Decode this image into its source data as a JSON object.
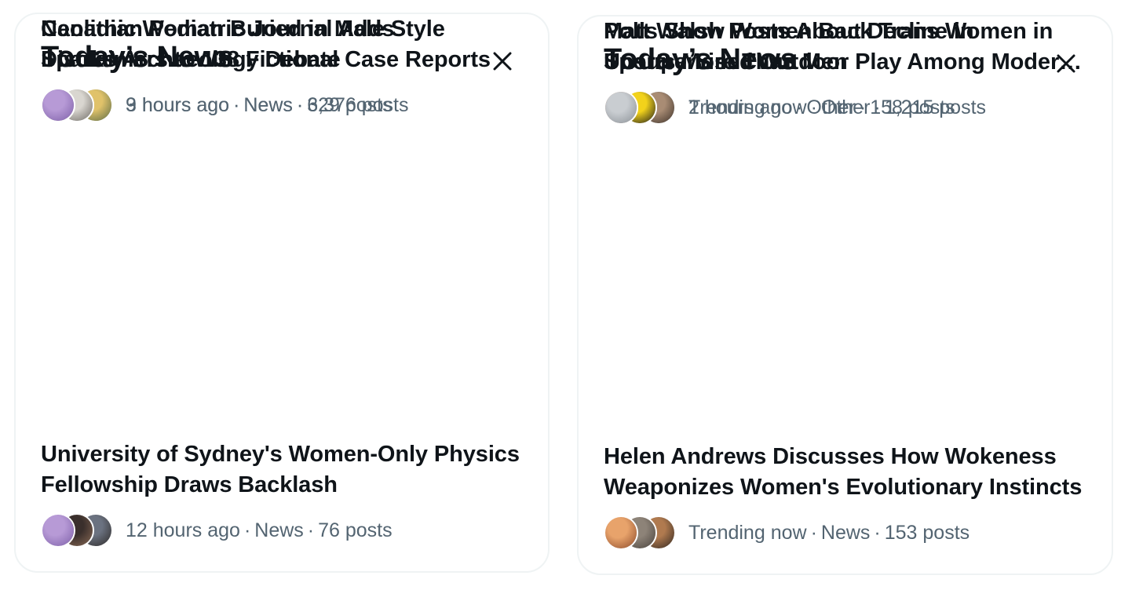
{
  "panels": [
    {
      "title": "Today’s News",
      "stories": [
        {
          "headline": "University of Sydney's Women-Only Physics Fellowship Draws Backlash",
          "time": "12 hours ago",
          "category": "News",
          "posts": "76 posts",
          "avatar_colors": [
            [
              "#b79ad6",
              "#7d5fa8"
            ],
            [
              "#3a2f2c",
              "#8a6a55"
            ],
            [
              "#6b7280",
              "#2d2a28"
            ]
          ]
        },
        {
          "headline": "Canadian Pediatric Journal Adds Disclaimers to 138 Fictional Case Reports",
          "time": "9 hours ago",
          "category": "News",
          "posts": "3,376 posts",
          "avatar_colors": [
            [
              "#2c3e50",
              "#c9a17a"
            ],
            [
              "#9aa1a6",
              "#3b4045"
            ],
            [
              "#7c8a7a",
              "#3d4639"
            ]
          ]
        },
        {
          "headline": "Neolithic Woman Buried in Male Style Sparks Archaeology Debate",
          "time": "3 hours ago",
          "category": "News",
          "posts": "629 posts",
          "avatar_colors": [
            [
              "#b79ad6",
              "#7d5fa8"
            ],
            [
              "#d9d6d0",
              "#6e6a64"
            ],
            [
              "#e0c26a",
              "#5b6b45"
            ]
          ]
        }
      ]
    },
    {
      "title": "Today’s News",
      "stories": [
        {
          "headline": "Helen Andrews Discusses How Wokeness Weaponizes Women's Evolutionary Instincts",
          "time": "Trending now",
          "category": "News",
          "posts": "153 posts",
          "avatar_colors": [
            [
              "#e8a36b",
              "#8c4a2a"
            ],
            [
              "#8d8378",
              "#4a433d"
            ],
            [
              "#b07a4f",
              "#2f2620"
            ]
          ]
        },
        {
          "headline": "Matt Walsh Posts About Decline in Unsupervised Outdoor Play Among Modern Kids",
          "time": "Trending now",
          "category": "Other",
          "posts": "1,215 posts",
          "avatar_colors": [
            [
              "#c0622f",
              "#2b1e18"
            ],
            [
              "#e2b48c",
              "#2c2421"
            ],
            [
              "#4b8fc8",
              "#1e2b36"
            ]
          ]
        },
        {
          "headline": "Polls Show Women Back Trans Women in Sports More Than Men",
          "time": "2 hours ago",
          "category": "Other",
          "posts": "158 posts",
          "avatar_colors": [
            [
              "#c9cdd1",
              "#8a9096"
            ],
            [
              "#f2d21b",
              "#1a1a1a"
            ],
            [
              "#a98c74",
              "#3d3129"
            ]
          ]
        }
      ]
    }
  ],
  "icons": {
    "close": "close-icon",
    "avatar": "avatar"
  },
  "colors": {
    "text_primary": "#0f1419",
    "text_secondary": "#536471",
    "border": "#eff3f4"
  }
}
